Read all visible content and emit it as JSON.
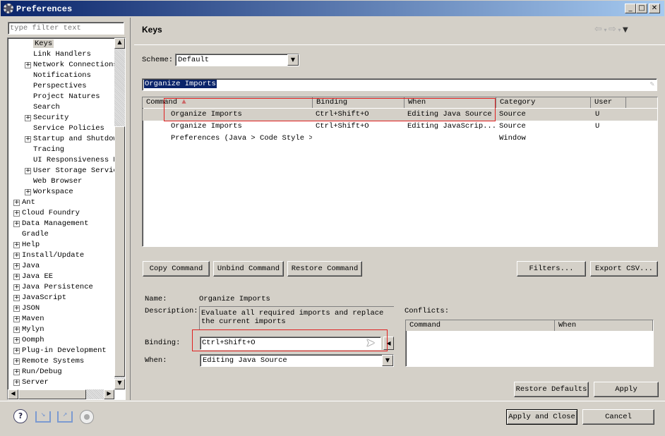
{
  "window": {
    "title": "Preferences"
  },
  "filter": {
    "placeholder": "type filter text"
  },
  "tree": {
    "items": [
      {
        "label": "Keys",
        "level": 2,
        "expandable": false,
        "selected": true
      },
      {
        "label": "Link Handlers",
        "level": 2,
        "expandable": false
      },
      {
        "label": "Network Connections",
        "level": 2,
        "expandable": true
      },
      {
        "label": "Notifications",
        "level": 2,
        "expandable": false
      },
      {
        "label": "Perspectives",
        "level": 2,
        "expandable": false
      },
      {
        "label": "Project Natures",
        "level": 2,
        "expandable": false
      },
      {
        "label": "Search",
        "level": 2,
        "expandable": false
      },
      {
        "label": "Security",
        "level": 2,
        "expandable": true
      },
      {
        "label": "Service Policies",
        "level": 2,
        "expandable": false
      },
      {
        "label": "Startup and Shutdow",
        "level": 2,
        "expandable": true
      },
      {
        "label": "Tracing",
        "level": 2,
        "expandable": false
      },
      {
        "label": "UI Responsiveness M",
        "level": 2,
        "expandable": false
      },
      {
        "label": "User Storage Servic",
        "level": 2,
        "expandable": true
      },
      {
        "label": "Web Browser",
        "level": 2,
        "expandable": false
      },
      {
        "label": "Workspace",
        "level": 2,
        "expandable": true
      },
      {
        "label": "Ant",
        "level": 1,
        "expandable": true
      },
      {
        "label": "Cloud Foundry",
        "level": 1,
        "expandable": true
      },
      {
        "label": "Data Management",
        "level": 1,
        "expandable": true
      },
      {
        "label": "Gradle",
        "level": 1,
        "expandable": false
      },
      {
        "label": "Help",
        "level": 1,
        "expandable": true
      },
      {
        "label": "Install/Update",
        "level": 1,
        "expandable": true
      },
      {
        "label": "Java",
        "level": 1,
        "expandable": true
      },
      {
        "label": "Java EE",
        "level": 1,
        "expandable": true
      },
      {
        "label": "Java Persistence",
        "level": 1,
        "expandable": true
      },
      {
        "label": "JavaScript",
        "level": 1,
        "expandable": true
      },
      {
        "label": "JSON",
        "level": 1,
        "expandable": true
      },
      {
        "label": "Maven",
        "level": 1,
        "expandable": true
      },
      {
        "label": "Mylyn",
        "level": 1,
        "expandable": true
      },
      {
        "label": "Oomph",
        "level": 1,
        "expandable": true
      },
      {
        "label": "Plug-in Development",
        "level": 1,
        "expandable": true
      },
      {
        "label": "Remote Systems",
        "level": 1,
        "expandable": true
      },
      {
        "label": "Run/Debug",
        "level": 1,
        "expandable": true
      },
      {
        "label": "Server",
        "level": 1,
        "expandable": true
      }
    ]
  },
  "page": {
    "title": "Keys"
  },
  "scheme": {
    "label": "Scheme:",
    "value": "Default"
  },
  "search": {
    "value": "Organize Imports"
  },
  "table": {
    "columns": [
      "Command",
      "Binding",
      "When",
      "Category",
      "User"
    ],
    "rows": [
      {
        "command": "Organize Imports",
        "binding": "Ctrl+Shift+O",
        "when": "Editing Java Source",
        "category": "Source",
        "user": "U",
        "selected": true
      },
      {
        "command": "Organize Imports",
        "binding": "Ctrl+Shift+O",
        "when": "Editing JavaScrip...",
        "category": "Source",
        "user": "U"
      },
      {
        "command": "Preferences (Java > Code Style > (",
        "binding": "",
        "when": "",
        "category": "Window",
        "user": ""
      }
    ]
  },
  "buttons": {
    "copy": "Copy Command",
    "unbind": "Unbind Command",
    "restore": "Restore Command",
    "filters": "Filters...",
    "export": "Export CSV...",
    "restore_defaults": "Restore Defaults",
    "apply": "Apply",
    "apply_close": "Apply and Close",
    "cancel": "Cancel"
  },
  "details": {
    "name_label": "Name:",
    "name": "Organize Imports",
    "description_label": "Description:",
    "description": "Evaluate all required imports and replace the current imports",
    "binding_label": "Binding:",
    "binding": "Ctrl+Shift+O",
    "when_label": "When:",
    "when": "Editing Java Source",
    "conflicts_label": "Conflicts:",
    "conflict_columns": [
      "Command",
      "When"
    ]
  },
  "colors": {
    "highlight_box": "#e02020",
    "selection": "#0a246a",
    "title_gradient_start": "#0a246a"
  }
}
